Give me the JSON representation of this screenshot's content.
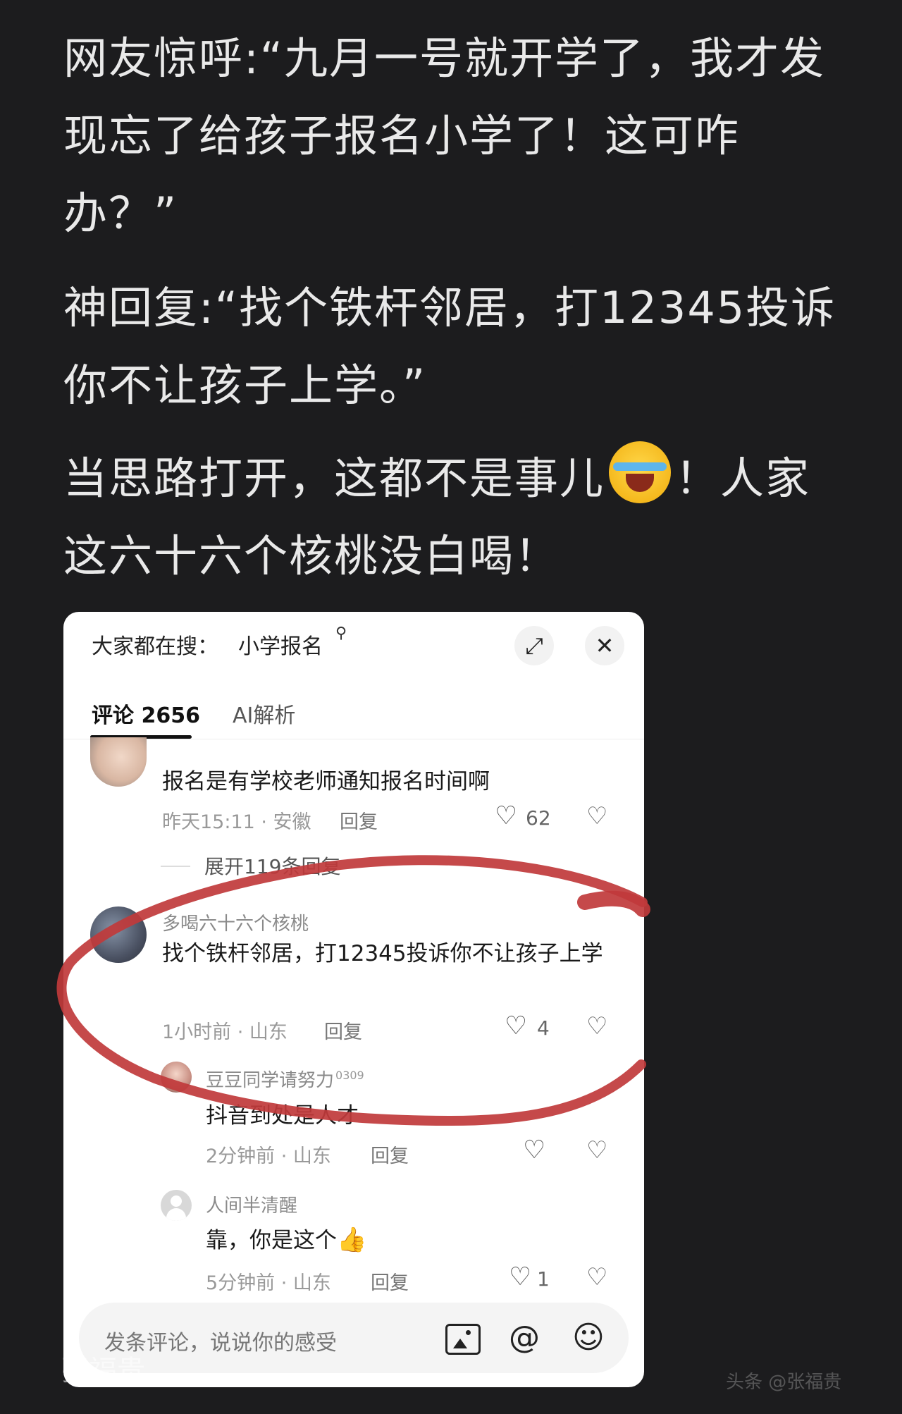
{
  "post": {
    "paragraph1": "网友惊呼:“九月一号就开学了，我才发现忘了给孩子报名小学了！这可咋办？”",
    "paragraph2": "神回复:“找个铁杆邻居，打12345投诉你不让孩子上学。”",
    "paragraph3_before_emoji": "当思路打开，这都不是事儿",
    "paragraph3_after_emoji": "！人家这六十六个核桃没白喝！"
  },
  "screenshot": {
    "search_prefix": "大家都在搜：",
    "search_query": "小学报名",
    "search_q_icon": "magnifier-icon",
    "tabs": [
      "评论 2656",
      "AI解析"
    ],
    "comments": [
      {
        "text": "报名是有学校老师通知报名时间啊",
        "time": "昨天15:11 · 安徽",
        "reply": "回复",
        "likes": "62"
      },
      {
        "expand": "展开119条回复"
      },
      {
        "name": "多喝六十六个核桃",
        "text": "找个铁杆邻居，打12345投诉你不让孩子上学",
        "time": "1小时前 · 山东",
        "reply": "回复",
        "likes": "4"
      },
      {
        "name": "豆豆同学请努力",
        "badge": "0309",
        "text": "抖音到处是人才",
        "time": "2分钟前 · 山东",
        "reply": "回复",
        "likes": ""
      },
      {
        "name": "人间半清醒",
        "text": "靠，你是这个",
        "time": "5分钟前 · 山东",
        "reply": "回复",
        "likes": "1"
      }
    ],
    "input_placeholder": "发条评论，说说你的感受",
    "icons": [
      "image-icon",
      "at-icon",
      "emoji-icon"
    ]
  },
  "watermark": {
    "left": "张福贵",
    "right": "头条 @张福贵"
  },
  "colors": {
    "background": "#1c1c1e",
    "body_text": "#e9e9e9",
    "annotation_red": "#c0393b"
  }
}
